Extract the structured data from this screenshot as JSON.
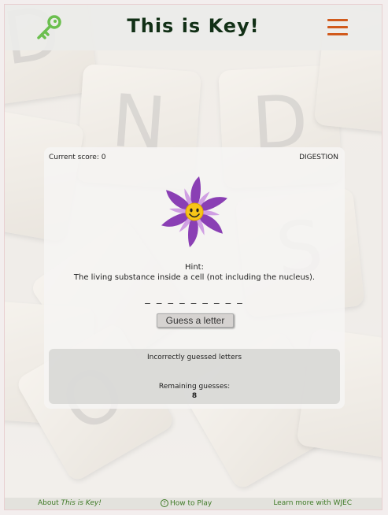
{
  "header": {
    "title": "This is Key!",
    "logo_icon": "key-icon",
    "menu_icon": "hamburger-menu-icon"
  },
  "game": {
    "score_label": "Current score: 0",
    "category": "DIGESTION",
    "hint_label": "Hint:",
    "hint_text": "The living substance inside a cell (not including the nucleus).",
    "word_blanks": "_ _ _ _ _ _ _ _ _",
    "guess_button": "Guess a letter",
    "incorrect_label": "Incorrectly guessed letters",
    "remaining_label": "Remaining guesses:",
    "remaining_value": "8",
    "mascot_icon": "smiling-flower-icon"
  },
  "footer": {
    "about_prefix": "About ",
    "about_name": "This is Key!",
    "how_to_play": "How to Play",
    "learn_more": "Learn more with WJEC"
  },
  "colors": {
    "title": "#123016",
    "menu_accent": "#d15a1c",
    "logo_green": "#6bbf4e",
    "footer_link": "#3e7a26",
    "flower_purple": "#8a3fb4"
  }
}
